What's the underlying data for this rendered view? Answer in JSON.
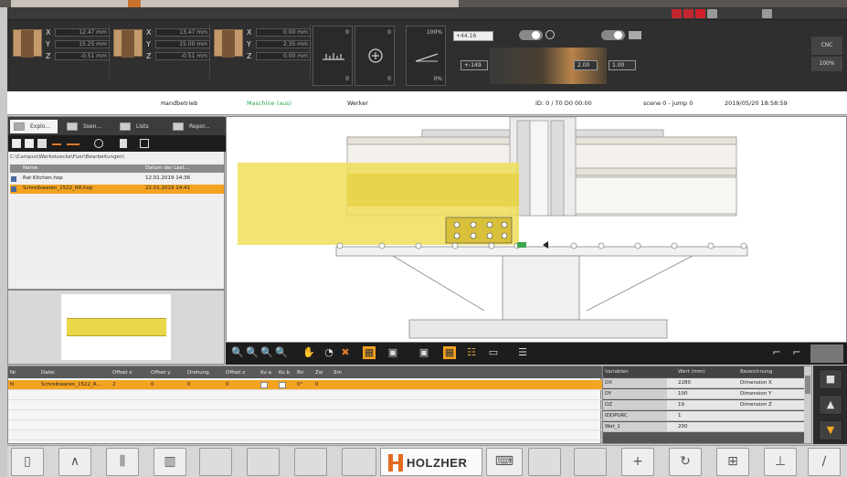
{
  "header": {
    "coords": [
      {
        "x": "12.47 mm",
        "y": "15.25 mm",
        "z": "-0.51 mm"
      },
      {
        "x": "13.47 mm",
        "y": "15.00 mm",
        "z": "-0.51 mm"
      },
      {
        "x": "0.00 mm",
        "y": "2.35 mm",
        "z": "0.00 mm"
      }
    ],
    "axis_labels": {
      "x": "X",
      "y": "Y",
      "z": "Z"
    },
    "gauge1": {
      "top": "0",
      "bottom": "0"
    },
    "gauge2": {
      "top": "0",
      "bottom": "0"
    },
    "gauge3": {
      "top": "100%",
      "bottom": "0%"
    },
    "input_top": "+44.16",
    "input_bottom": "+-149",
    "feed_value": "1.00",
    "unit_label": "2.00",
    "right_panel": {
      "mode": "CNC",
      "percent": "100%"
    },
    "sys_icons": [
      "info-icon",
      "print-icon",
      "pdf-icon",
      "save-icon",
      "lock-icon"
    ]
  },
  "statusbar": {
    "mode": "Handbetrieb",
    "machine_state": "Maschine (aus)",
    "worker": "Werker",
    "job_id": "ID: 0 / T0 D0 00:00",
    "scene": "scene 0 - jump 0",
    "datetime": "2019/05/20 18:58:59"
  },
  "explorer": {
    "tabs": [
      "Explo...",
      "Ssen...",
      "Lists",
      "Repor..."
    ],
    "path": "C:\\Campus\\Werkstuecke\\Fuer\\Bearbeitungen\\",
    "columns": [
      "Name",
      "Datum der Last..."
    ],
    "files": [
      {
        "name": "Rat Kitchen.hop",
        "date": "12.01.2019 14:36"
      },
      {
        "name": "Schreibwaren_1522_RR.hop",
        "date": "22.01.2019 14:41"
      }
    ]
  },
  "program": {
    "columns": [
      "Nr.",
      "Datei",
      "Offset x",
      "Offset y",
      "Drehung",
      "Offset z",
      "Ku a",
      "Ku b",
      "Bri",
      "Zw",
      "Sm"
    ],
    "rows": [
      {
        "nr": "N",
        "file": "Schreibwaren_1522_R...",
        "ox": "2",
        "oy": "0",
        "rot": "0",
        "oz": "0",
        "ka": "",
        "kb": "",
        "bri": "0°",
        "zw": "0",
        "sm": ""
      }
    ]
  },
  "params": {
    "columns": [
      "Variablen",
      "Wert (mm)",
      "Bezeichnung"
    ],
    "rows": [
      {
        "var": "DX",
        "val": "2280",
        "desc": "Dimension X"
      },
      {
        "var": "DY",
        "val": "100",
        "desc": "Dimension Y"
      },
      {
        "var": "DZ",
        "val": "19",
        "desc": "Dimension Z"
      },
      {
        "var": "IDDPURC",
        "val": "1",
        "desc": ""
      },
      {
        "var": "Wat_1",
        "val": "200",
        "desc": ""
      }
    ]
  },
  "bottombar": {
    "logo_text": "HOLZHER",
    "left_icons": [
      "door-icon",
      "compass-icon",
      "tools-icon",
      "panel-icon"
    ],
    "right_icons": [
      "add-icon",
      "refresh-icon",
      "add-part-icon",
      "machine-icon",
      "edit-icon"
    ]
  },
  "colors": {
    "accent": "#f3a320",
    "highlight": "#ecd74a",
    "brand": "#e36b1f"
  }
}
